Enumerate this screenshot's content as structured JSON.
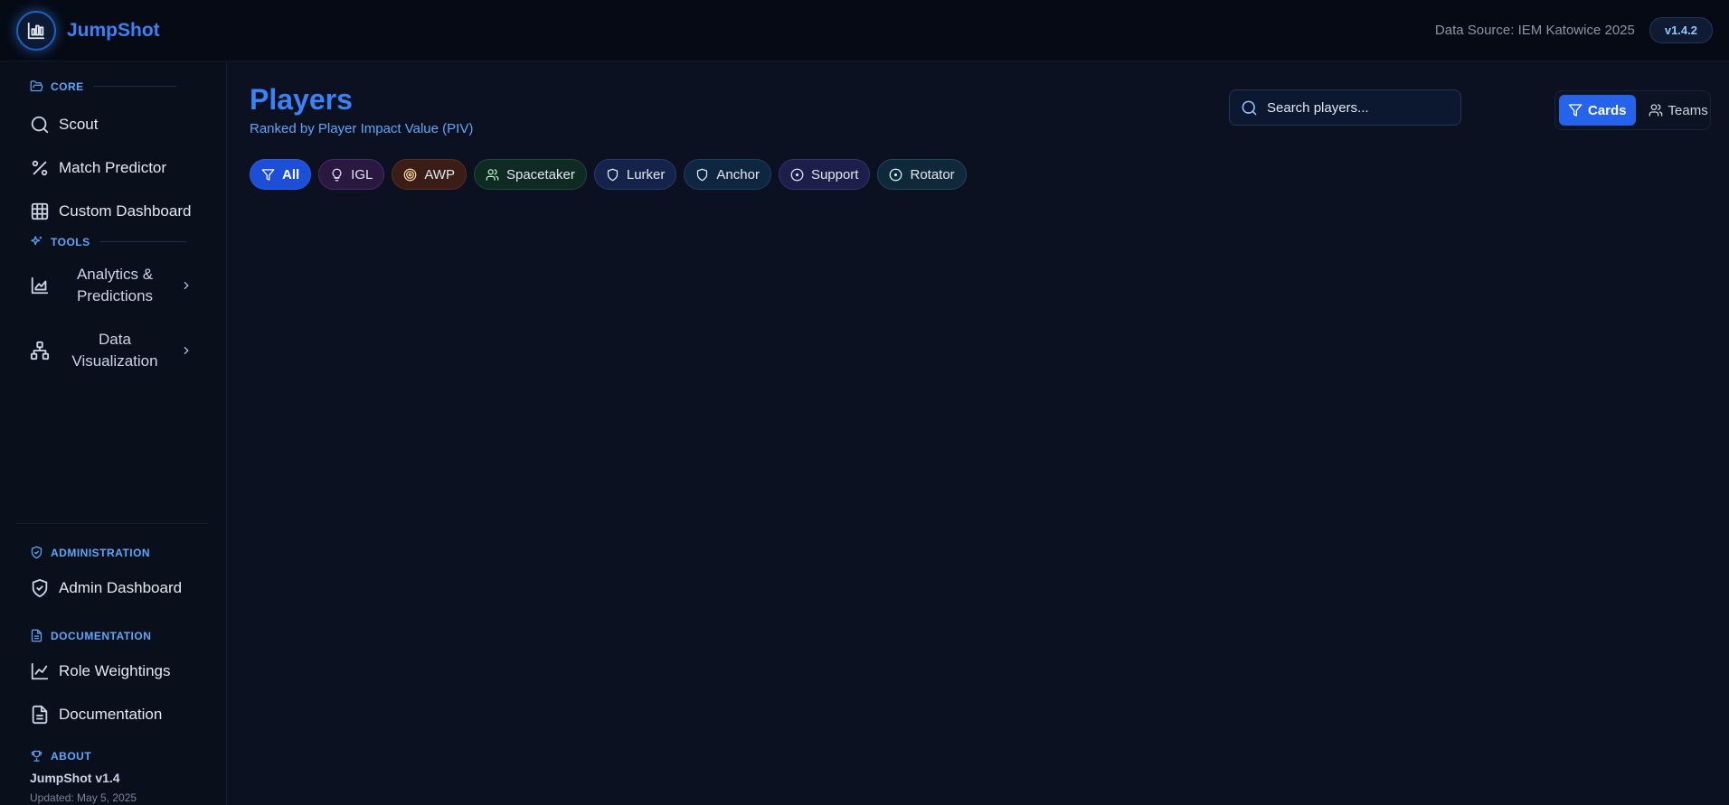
{
  "app": {
    "name": "JumpShot",
    "data_source": "Data Source: IEM Katowice 2025",
    "version": "v1.4.2"
  },
  "sidebar": {
    "core_label": "CORE",
    "core_items": [
      {
        "label": "Scout",
        "icon": "search-icon"
      },
      {
        "label": "Match Predictor",
        "icon": "percent-icon"
      },
      {
        "label": "Custom Dashboard",
        "icon": "grid-icon"
      }
    ],
    "tools_label": "TOOLS",
    "tools_groups": [
      {
        "label": "Analytics & Predictions",
        "icon": "chart-area-icon"
      },
      {
        "label": "Data Visualization",
        "icon": "network-icon"
      }
    ],
    "admin_label": "ADMINISTRATION",
    "admin_items": [
      {
        "label": "Admin Dashboard",
        "icon": "shield-check-icon"
      }
    ],
    "docs_label": "DOCUMENTATION",
    "docs_items": [
      {
        "label": "Role Weightings",
        "icon": "line-chart-icon"
      },
      {
        "label": "Documentation",
        "icon": "file-text-icon"
      }
    ],
    "about_label": "ABOUT",
    "about_title": "JumpShot v1.4",
    "about_updated": "Updated: May 5, 2025"
  },
  "main": {
    "title": "Players",
    "subtitle": "Ranked by Player Impact Value (PIV)",
    "search_placeholder": "Search players...",
    "view_toggle": {
      "cards": "Cards",
      "teams": "Teams",
      "active": "Cards"
    },
    "filters": [
      {
        "label": "All",
        "icon": "filter-icon",
        "active": true
      },
      {
        "label": "IGL",
        "icon": "lightbulb-icon"
      },
      {
        "label": "AWP",
        "icon": "target-icon"
      },
      {
        "label": "Spacetaker",
        "icon": "users-icon"
      },
      {
        "label": "Lurker",
        "icon": "shield-icon"
      },
      {
        "label": "Anchor",
        "icon": "shield-icon"
      },
      {
        "label": "Support",
        "icon": "circle-dot-icon"
      },
      {
        "label": "Rotator",
        "icon": "circle-dot-icon"
      }
    ]
  },
  "colors": {
    "accent": "#3b82f6",
    "background": "#0b1120",
    "sidebar": "#0a0f1c",
    "header": "#050a14"
  }
}
